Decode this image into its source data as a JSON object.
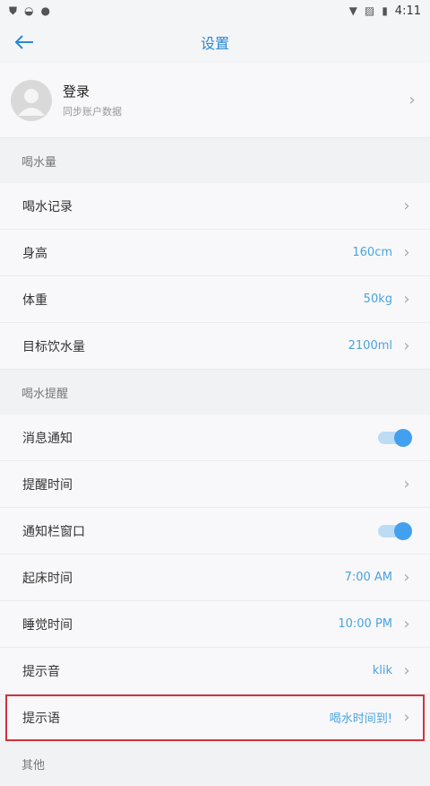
{
  "status": {
    "time": "4:11"
  },
  "header": {
    "title": "设置"
  },
  "login": {
    "name": "登录",
    "subtitle": "同步账户数据"
  },
  "sections": [
    {
      "title": "喝水量",
      "rows": [
        {
          "label": "喝水记录",
          "value": ""
        },
        {
          "label": "身高",
          "value": "160cm"
        },
        {
          "label": "体重",
          "value": "50kg"
        },
        {
          "label": "目标饮水量",
          "value": "2100ml"
        }
      ]
    },
    {
      "title": "喝水提醒",
      "rows": [
        {
          "label": "消息通知",
          "toggle": true
        },
        {
          "label": "提醒时间",
          "value": ""
        },
        {
          "label": "通知栏窗口",
          "toggle": true
        },
        {
          "label": "起床时间",
          "value": "7:00 AM"
        },
        {
          "label": "睡觉时间",
          "value": "10:00 PM"
        },
        {
          "label": "提示音",
          "value": "klik"
        },
        {
          "label": "提示语",
          "value": "喝水时间到!"
        }
      ]
    },
    {
      "title": "其他",
      "rows": []
    }
  ],
  "colors": {
    "accent": "#2a89d6",
    "value": "#4aa3df",
    "highlight": "#d0333b"
  }
}
